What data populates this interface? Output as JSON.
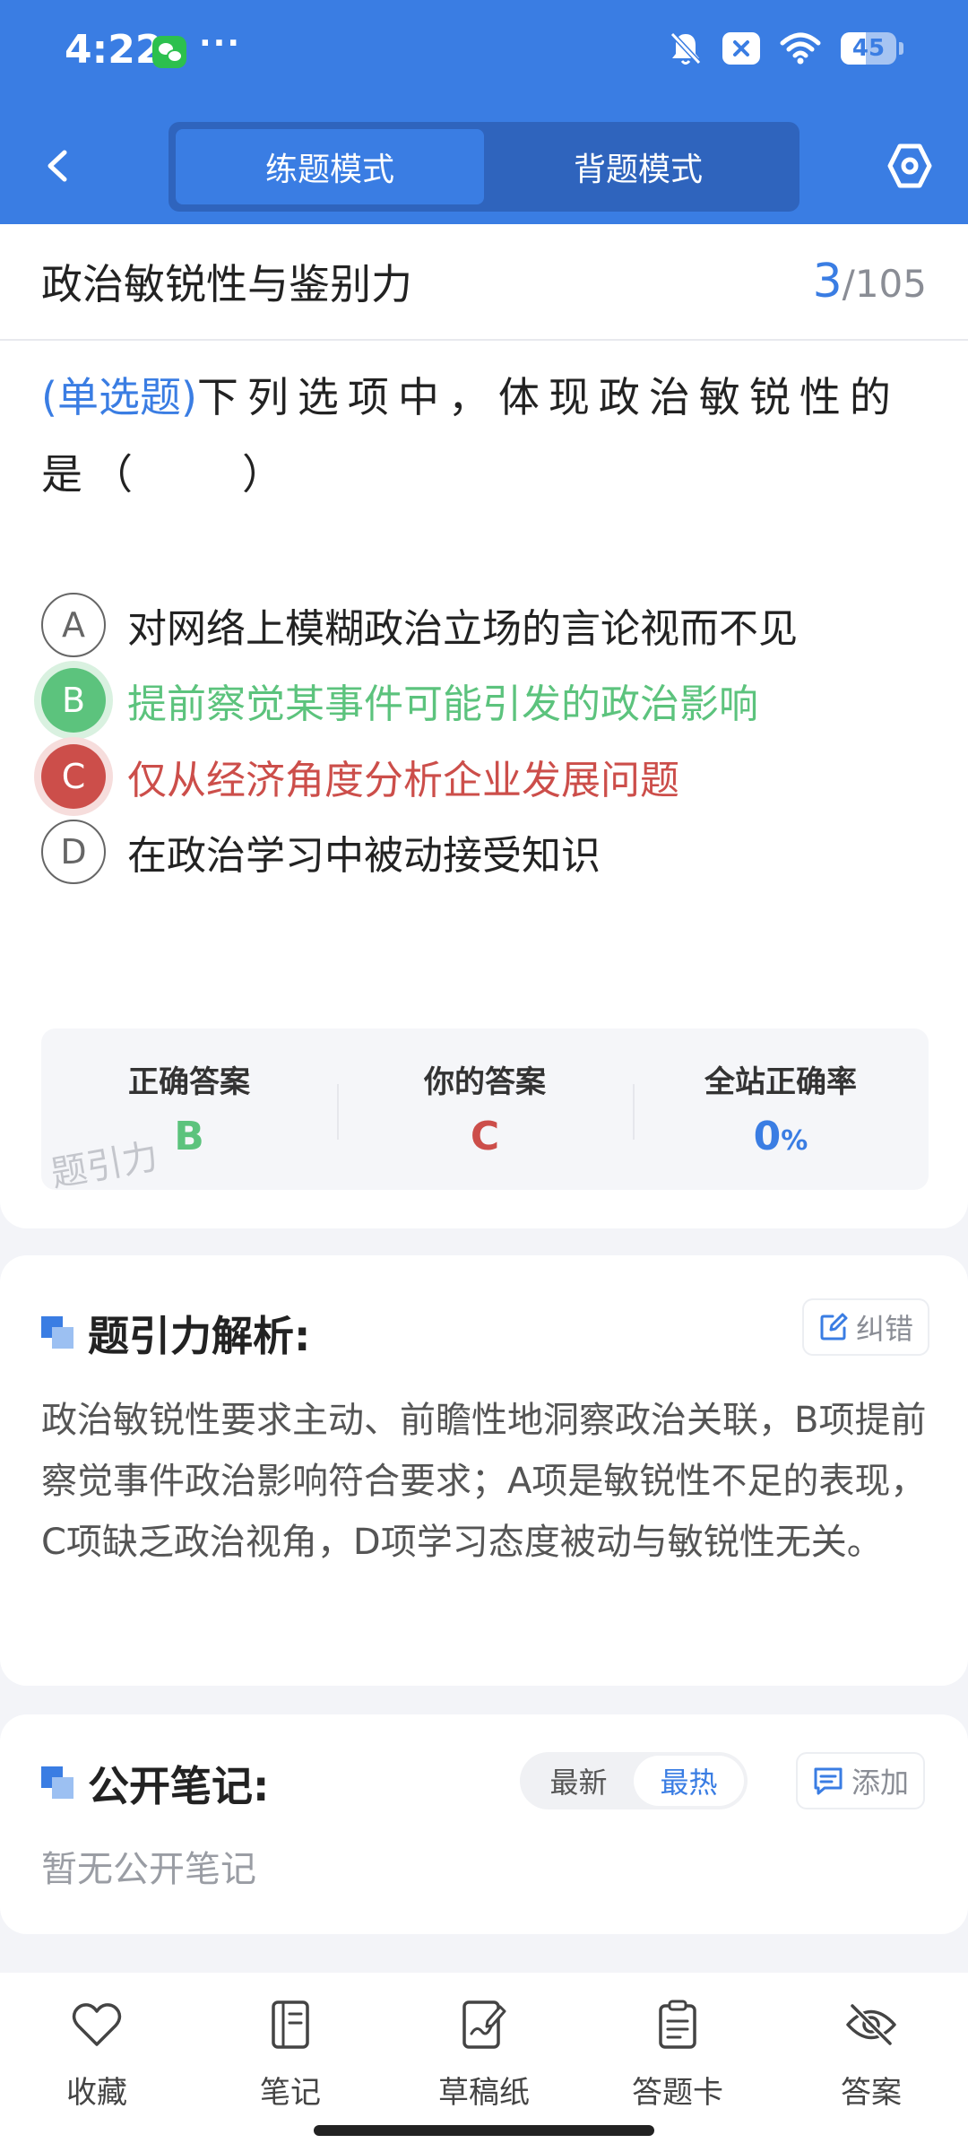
{
  "status_bar": {
    "time": "4:22",
    "dots": "···",
    "battery": "45",
    "battery_level": 0.45
  },
  "header": {
    "tabs": [
      {
        "label": "练题模式",
        "active": true
      },
      {
        "label": "背题模式",
        "active": false
      }
    ]
  },
  "question": {
    "category": "政治敏锐性与鉴别力",
    "current": "3",
    "total": "/105",
    "type": "(单选题)",
    "text": "下列选项中，体现政治敏锐性的是（　　）",
    "options": [
      {
        "letter": "A",
        "text": "对网络上模糊政治立场的言论视而不见",
        "state": "normal"
      },
      {
        "letter": "B",
        "text": "提前察觉某事件可能引发的政治影响",
        "state": "correct"
      },
      {
        "letter": "C",
        "text": "仅从经济角度分析企业发展问题",
        "state": "wrong"
      },
      {
        "letter": "D",
        "text": "在政治学习中被动接受知识",
        "state": "normal"
      }
    ]
  },
  "answer_summary": {
    "correct_label": "正确答案",
    "correct_value": "B",
    "yours_label": "你的答案",
    "yours_value": "C",
    "rate_label": "全站正确率",
    "rate_value": "0",
    "rate_unit": "%",
    "watermark": "题引力"
  },
  "analysis": {
    "title": "题引力解析:",
    "report_label": "纠错",
    "text": "政治敏锐性要求主动、前瞻性地洞察政治关联，B项提前察觉事件政治影响符合要求；A项是敏锐性不足的表现，C项缺乏政治视角，D项学习态度被动与敏锐性无关。"
  },
  "notes": {
    "title": "公开笔记:",
    "sort_options": [
      "最新",
      "最热"
    ],
    "sort_active": "最热",
    "add_label": "添加",
    "empty_text": "暂无公开笔记"
  },
  "bottom_bar": [
    {
      "label": "收藏",
      "icon": "heart-icon"
    },
    {
      "label": "笔记",
      "icon": "notebook-icon"
    },
    {
      "label": "草稿纸",
      "icon": "draft-icon"
    },
    {
      "label": "答题卡",
      "icon": "clipboard-icon"
    },
    {
      "label": "答案",
      "icon": "eye-off-icon"
    }
  ],
  "colors": {
    "primary": "#3a7de3",
    "correct": "#5cc37d",
    "wrong": "#cc4e4a"
  }
}
